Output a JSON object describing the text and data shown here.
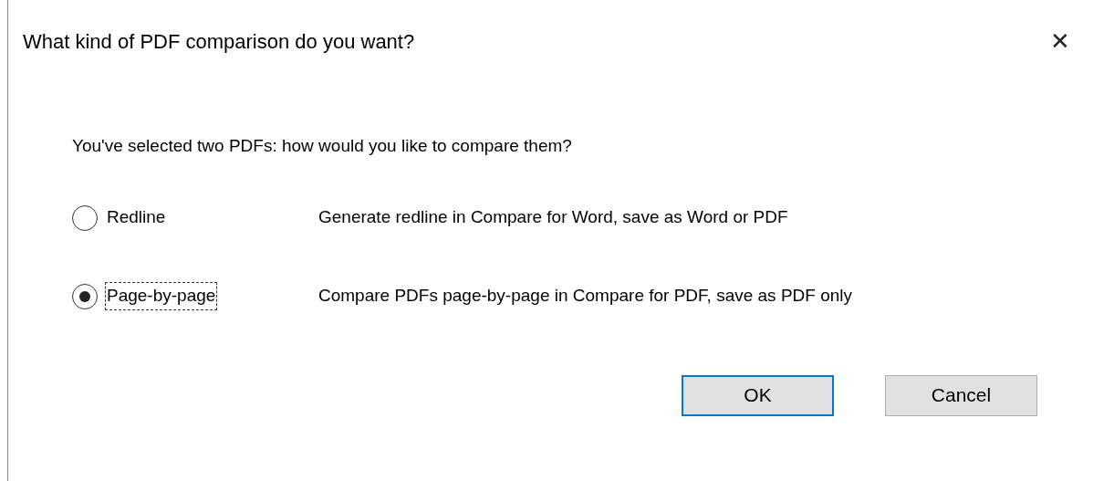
{
  "window": {
    "title": "What kind of PDF comparison do you want?",
    "close": "✕"
  },
  "prompt": "You've selected two PDFs: how would you like to compare them?",
  "options": [
    {
      "label": "Redline",
      "description": "Generate redline in Compare for Word, save as Word or PDF",
      "selected": false,
      "focused": false
    },
    {
      "label": "Page-by-page",
      "description": "Compare PDFs page-by-page in Compare for PDF, save as PDF only",
      "selected": true,
      "focused": true
    }
  ],
  "buttons": [
    {
      "label": "OK",
      "default": true
    },
    {
      "label": "Cancel",
      "default": false
    }
  ]
}
